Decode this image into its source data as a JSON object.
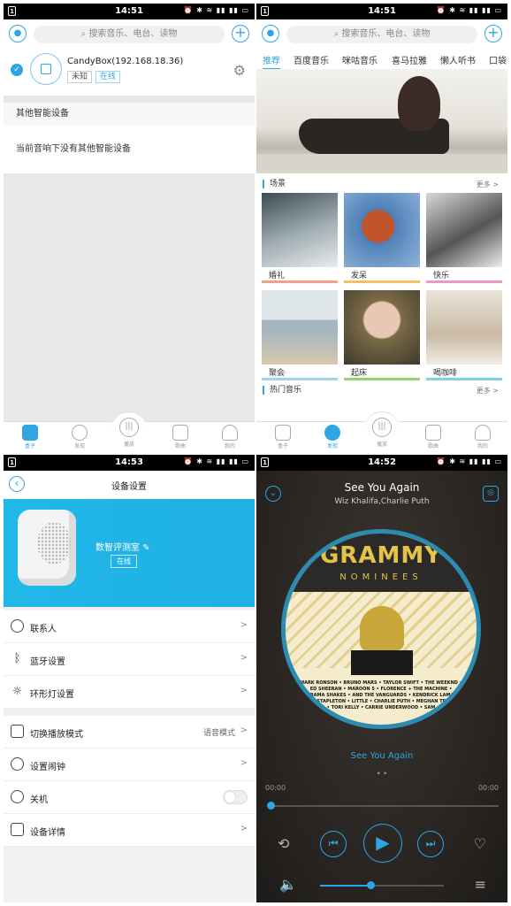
{
  "status_bar": {
    "sim": "1",
    "time_p1": "14:51",
    "time_p2": "14:51",
    "time_p3": "14:53",
    "time_p4": "14:52",
    "icons": "⏰ ✱ ≋ ▮▮ ▮▮ ▭"
  },
  "search": {
    "placeholder": "搜索音乐、电台、读物"
  },
  "bottom_tabs": [
    "盒子",
    "发现",
    "播放",
    "歌曲",
    "我的"
  ],
  "devices": {
    "current": {
      "name": "CandyBox(192.168.18.36)",
      "tag_unknown": "未知",
      "tag_online": "在线"
    },
    "other_section_title": "其他智能设备",
    "other_empty_text": "当前音响下没有其他智能设备"
  },
  "discover": {
    "tabs": [
      "推荐",
      "百度音乐",
      "咪咕音乐",
      "喜马拉雅",
      "懒人听书",
      "口袋"
    ],
    "scene_title": "场景",
    "more": "更多 >",
    "scenes": [
      "婚礼",
      "发呆",
      "快乐",
      "聚会",
      "起床",
      "喝咖啡"
    ],
    "hot_title": "热门音乐"
  },
  "settings": {
    "title": "设备设置",
    "device_name": "数智评测室 ✎",
    "device_status": "在线",
    "rows": [
      "联系人",
      "蓝牙设置",
      "环形灯设置"
    ],
    "rows2": [
      "切换播放模式",
      "设置闹钟",
      "关机",
      "设备详情"
    ],
    "mode_value": "语音模式",
    "chevron": ">"
  },
  "player": {
    "title": "See You Again",
    "artist": "Wiz Khalifa,Charlie Puth",
    "album_title": "GRAMMY",
    "album_sub": "NOMINEES",
    "album_text": "MARK RONSON • BRUNO MARS • TAYLOR SWIFT • THE WEEKND • ED SHEERAN • MAROON 5 • FLORENCE + THE MACHINE • ALABAMA SHAKES • AND THE VANGUARDS • KENDRICK LAMAR • CHRIS STAPLETON • LITTLE • CHARLIE PUTH • MEGHAN TRAINOR • TORI KELLY • CARRIE UNDERWOOD • SAM",
    "lyric": "See You Again",
    "page_dots": "• •",
    "time_elapsed": "00:00",
    "time_total": "00:00",
    "progress": 0,
    "volume": 0.41
  },
  "colors": {
    "accent": "#2fa6e3",
    "hero": "#21b8e8"
  }
}
